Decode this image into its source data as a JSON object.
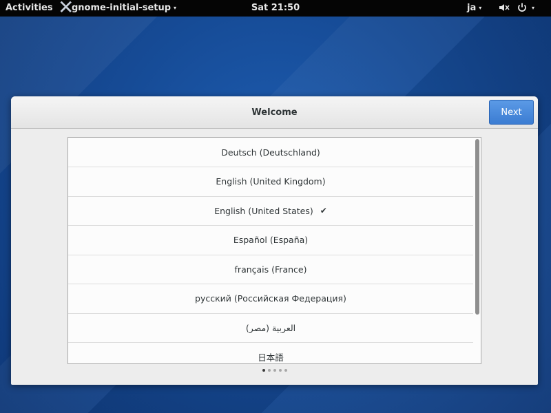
{
  "topbar": {
    "activities": "Activities",
    "app_name": "gnome-initial-setup",
    "clock": "Sat 21:50",
    "input_source": "ja",
    "caret": "▾"
  },
  "dialog": {
    "title": "Welcome",
    "next_label": "Next",
    "languages": [
      {
        "label": "Deutsch (Deutschland)",
        "selected": false
      },
      {
        "label": "English (United Kingdom)",
        "selected": false
      },
      {
        "label": "English (United States)",
        "selected": true
      },
      {
        "label": "Español (España)",
        "selected": false
      },
      {
        "label": "français (France)",
        "selected": false
      },
      {
        "label": "русский (Российская Федерация)",
        "selected": false
      },
      {
        "label": "العربية (مصر)",
        "selected": false
      },
      {
        "label": "日本語",
        "selected": false
      }
    ],
    "check_mark": "✔",
    "page_dots": {
      "count": 5,
      "active": 1
    }
  },
  "icons": [
    "logo-x-icon",
    "volume-muted-icon",
    "power-icon",
    "checkmark-icon"
  ],
  "colors": {
    "accent": "#3b7cd2",
    "desktop": "#164b96",
    "topbar": "#050505"
  }
}
